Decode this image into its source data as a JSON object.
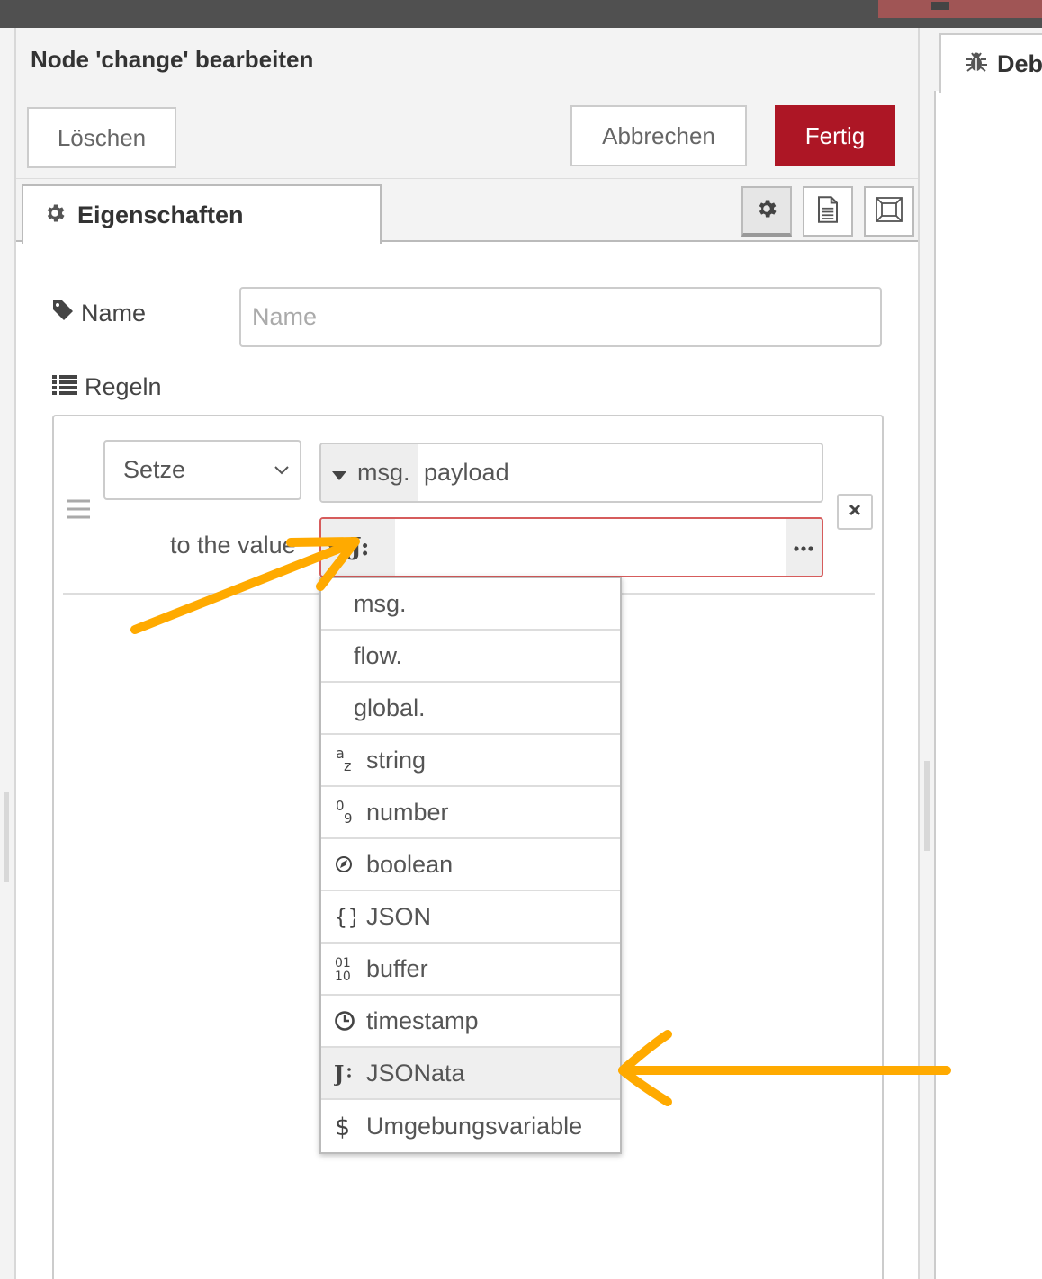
{
  "editor": {
    "title": "Node 'change' bearbeiten",
    "delete_label": "Löschen",
    "cancel_label": "Abbrechen",
    "done_label": "Fertig",
    "tab_label": "Eigenschaften"
  },
  "form": {
    "name_label": "Name",
    "name_placeholder": "Name",
    "name_value": "",
    "rules_label": "Regeln"
  },
  "rule": {
    "action": "Setze",
    "property_prefix": "msg.",
    "property_value": "payload",
    "to_label": "to the value",
    "value_type_icon": "J:",
    "value": ""
  },
  "type_menu": {
    "items": [
      {
        "label": "msg.",
        "icon": ""
      },
      {
        "label": "flow.",
        "icon": ""
      },
      {
        "label": "global.",
        "icon": ""
      },
      {
        "label": "string",
        "icon": "az-icon"
      },
      {
        "label": "number",
        "icon": "09-icon"
      },
      {
        "label": "boolean",
        "icon": "boolean-icon"
      },
      {
        "label": "JSON",
        "icon": "braces-icon"
      },
      {
        "label": "buffer",
        "icon": "binary-icon"
      },
      {
        "label": "timestamp",
        "icon": "clock-icon"
      },
      {
        "label": "JSONata",
        "icon": "jsonata-icon"
      },
      {
        "label": "Umgebungsvariable",
        "icon": "dollar-icon"
      }
    ],
    "highlighted": "JSONata"
  },
  "sidebar": {
    "tab_label": "Deb"
  },
  "colors": {
    "primary": "#ad1625",
    "annotation": "#ffaa00",
    "error_border": "#d65c5c"
  }
}
